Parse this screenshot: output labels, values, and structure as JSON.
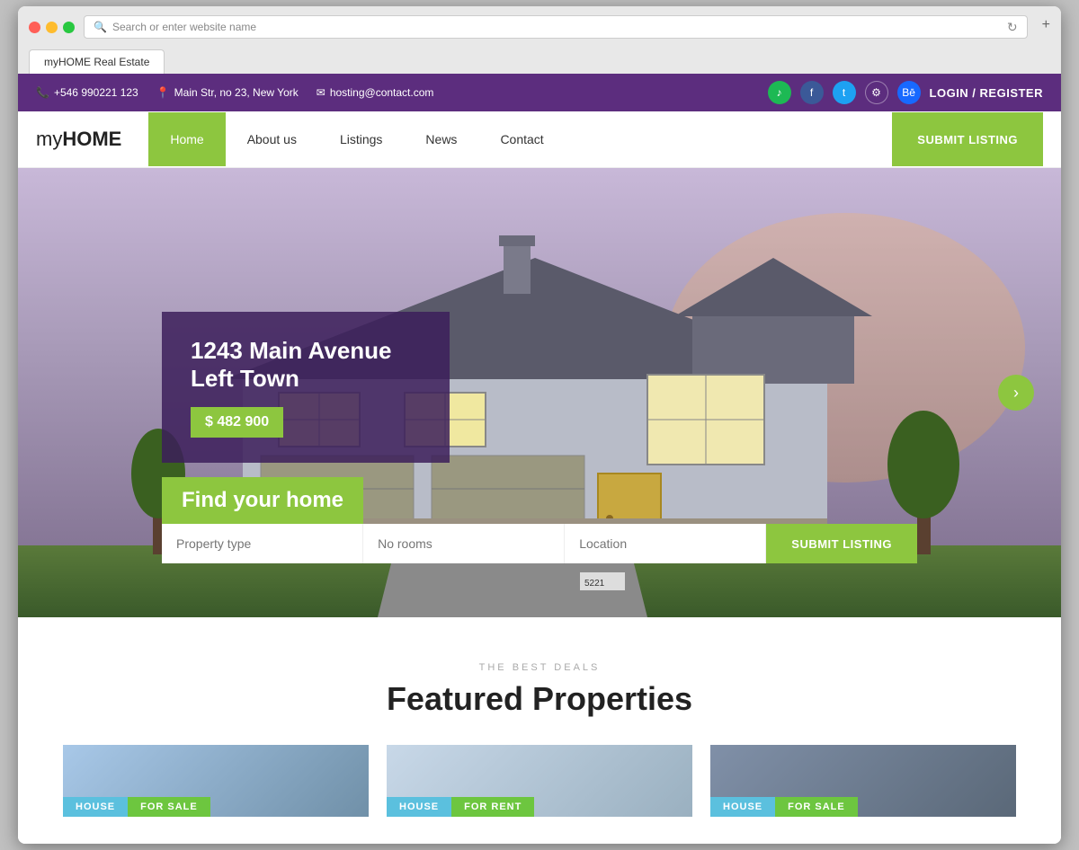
{
  "browser": {
    "tab_label": "myHOME Real Estate",
    "address_placeholder": "Search or enter website name",
    "new_tab_icon": "+"
  },
  "topbar": {
    "phone": "+546 990221 123",
    "address": "Main Str, no 23, New York",
    "email": "hosting@contact.com",
    "social": [
      "spotify",
      "facebook",
      "twitter",
      "settings",
      "behance"
    ],
    "login": "LOGIN / REGISTER"
  },
  "nav": {
    "logo_my": "my",
    "logo_home": "HOME",
    "links": [
      {
        "label": "Home",
        "active": true
      },
      {
        "label": "About us",
        "active": false
      },
      {
        "label": "Listings",
        "active": false
      },
      {
        "label": "News",
        "active": false
      },
      {
        "label": "Contact",
        "active": false
      }
    ],
    "submit_btn": "SUBMIT LISTING"
  },
  "hero": {
    "address_title": "1243 Main Avenue Left Town",
    "price": "$ 482 900",
    "find_home": "Find your home",
    "search_fields": {
      "property_type": "Property type",
      "no_rooms": "No rooms",
      "location": "Location"
    },
    "submit_btn": "SUBMIT LISTING",
    "slider_next": "›"
  },
  "featured": {
    "subtitle": "THE BEST DEALS",
    "title": "Featured Properties",
    "cards": [
      {
        "type": "HOUSE",
        "status": "FOR SALE",
        "bg": 1
      },
      {
        "type": "HOUSE",
        "status": "FOR RENT",
        "bg": 2
      },
      {
        "type": "HOUSE",
        "status": "FOR SALE",
        "bg": 3
      }
    ]
  }
}
